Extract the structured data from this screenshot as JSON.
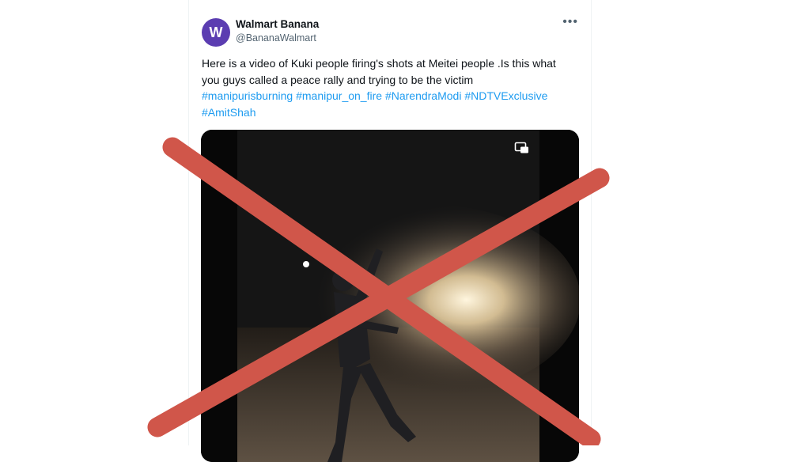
{
  "tweet": {
    "avatar_letter": "W",
    "avatar_color": "#5b3db1",
    "display_name": "Walmart Banana",
    "handle": "@BananaWalmart",
    "more_icon": "more-horizontal-icon",
    "text_line1": "Here is a video of Kuki people firing's shots at Meitei people .Is this what",
    "text_line2": "you guys called a peace rally and trying to be the victim",
    "hashtags": [
      "#manipurisburning",
      "#manipur_on_fire",
      "#NarendraModi",
      "#NDTVExclusive",
      "#AmitShah"
    ],
    "hashtag_color": "#1d9bf0"
  },
  "media": {
    "type": "video",
    "pip_icon": "picture-in-picture-icon"
  },
  "overlay": {
    "mark": "red-x",
    "color": "#d0564a"
  }
}
